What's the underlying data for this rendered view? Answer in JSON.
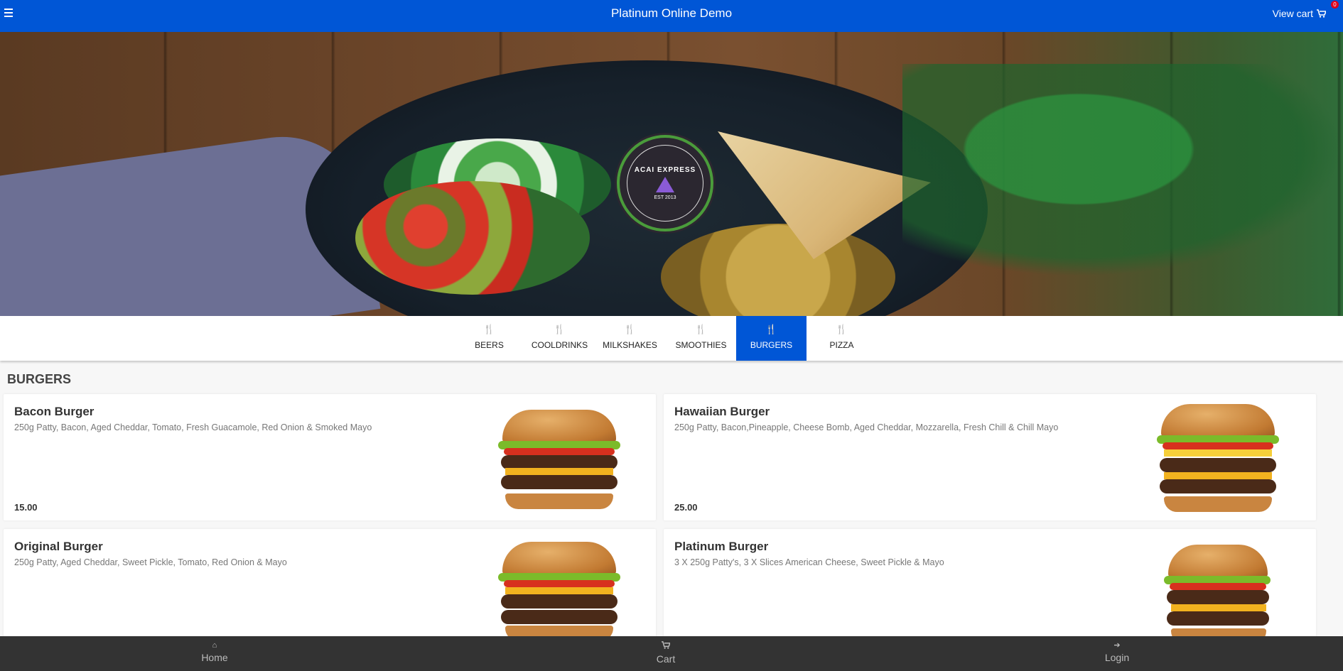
{
  "header": {
    "title": "Platinum Online Demo",
    "view_cart_label": "View cart",
    "cart_count": "0",
    "menu_icon": "hamburger-icon",
    "cart_icon": "shopping-cart-icon",
    "background_color": "#0056d6"
  },
  "hero": {
    "logo_text": "ACAI EXPRESS",
    "logo_est": "EST 2013"
  },
  "categories": {
    "active": "BURGERS",
    "items": [
      {
        "label": "BEERS",
        "icon": "cutlery-icon"
      },
      {
        "label": "COOLDRINKS",
        "icon": "cutlery-icon"
      },
      {
        "label": "MILKSHAKES",
        "icon": "cutlery-icon"
      },
      {
        "label": "SMOOTHIES",
        "icon": "cutlery-icon"
      },
      {
        "label": "BURGERS",
        "icon": "cutlery-icon"
      },
      {
        "label": "PIZZA",
        "icon": "cutlery-icon"
      }
    ]
  },
  "section": {
    "title": "BURGERS"
  },
  "products": [
    {
      "name": "Bacon Burger",
      "description": "250g Patty, Bacon, Aged Cheddar, Tomato, Fresh Guacamole, Red Onion & Smoked Mayo",
      "price": "15.00"
    },
    {
      "name": "Hawaiian Burger",
      "description": "250g Patty, Bacon,Pineapple, Cheese Bomb, Aged Cheddar, Mozzarella, Fresh Chill & Chill Mayo",
      "price": "25.00"
    },
    {
      "name": "Original Burger",
      "description": "250g Patty, Aged Cheddar, Sweet Pickle, Tomato, Red Onion & Mayo",
      "price": ""
    },
    {
      "name": "Platinum Burger",
      "description": "3 X 250g Patty's, 3 X Slices American Cheese, Sweet Pickle & Mayo",
      "price": ""
    }
  ],
  "bottom_nav": {
    "items": [
      {
        "label": "Home",
        "icon": "home-icon"
      },
      {
        "label": "Cart",
        "icon": "shopping-cart-icon"
      },
      {
        "label": "Login",
        "icon": "sign-in-icon"
      }
    ]
  }
}
